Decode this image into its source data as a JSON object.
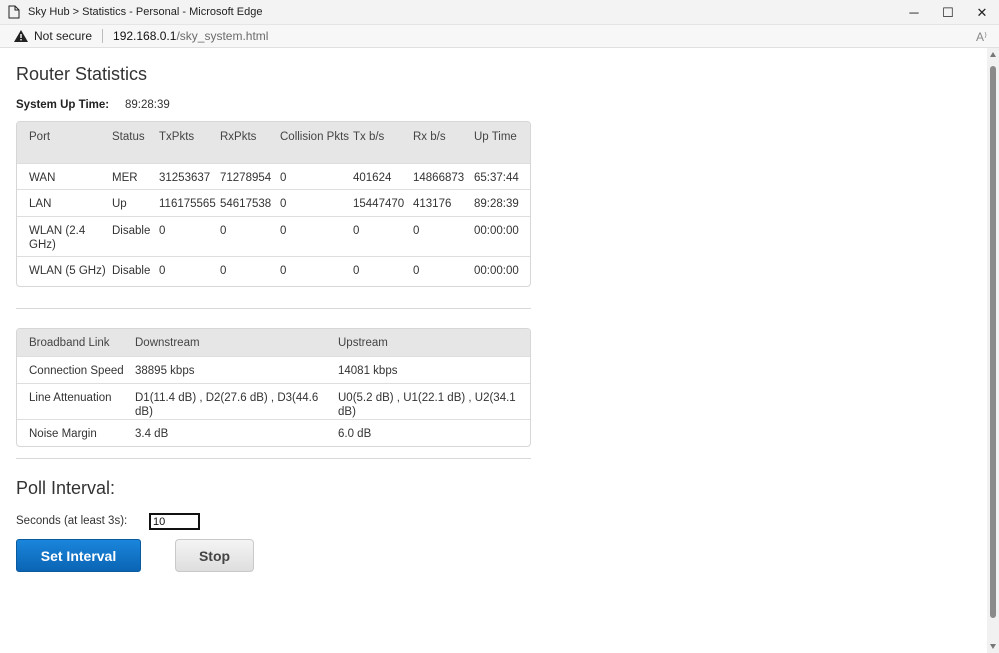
{
  "window": {
    "title": "Sky Hub > Statistics - Personal - Microsoft Edge",
    "controls": {
      "minimize": "─",
      "maximize": "☐",
      "close": "✕"
    }
  },
  "addressbar": {
    "security_label": "Not secure",
    "url_host": "192.168.0.1",
    "url_path": "/sky_system.html",
    "read_aloud_icon": "A⁾"
  },
  "page": {
    "title": "Router Statistics",
    "uptime": {
      "label": "System Up Time:",
      "value": "89:28:39"
    }
  },
  "port_table": {
    "headers": [
      "Port",
      "Status",
      "TxPkts",
      "RxPkts",
      "Collision Pkts",
      "Tx b/s",
      "Rx b/s",
      "Up Time"
    ],
    "rows": [
      [
        "WAN",
        "MER",
        "31253637",
        "71278954",
        "0",
        "401624",
        "14866873",
        "65:37:44"
      ],
      [
        "LAN",
        "Up",
        "116175565",
        "54617538",
        "0",
        "15447470",
        "413176",
        "89:28:39"
      ],
      [
        "WLAN (2.4 GHz)",
        "Disable",
        "0",
        "0",
        "0",
        "0",
        "0",
        "00:00:00"
      ],
      [
        "WLAN (5 GHz)",
        "Disable",
        "0",
        "0",
        "0",
        "0",
        "0",
        "00:00:00"
      ]
    ]
  },
  "broadband_table": {
    "headers": [
      "Broadband Link",
      "Downstream",
      "Upstream"
    ],
    "rows": [
      [
        "Connection Speed",
        "38895 kbps",
        "14081 kbps"
      ],
      [
        "Line Attenuation",
        "D1(11.4 dB) , D2(27.6 dB) , D3(44.6 dB)",
        "U0(5.2 dB) , U1(22.1 dB) , U2(34.1 dB)"
      ],
      [
        "Noise Margin",
        "3.4 dB",
        "6.0 dB"
      ]
    ]
  },
  "poll": {
    "title": "Poll Interval:",
    "seconds_label": "Seconds (at least 3s):",
    "seconds_value": "10",
    "set_button": "Set Interval",
    "stop_button": "Stop"
  },
  "colors": {
    "primary_button": "#0b64b4",
    "table_header": "#e6e6e6"
  }
}
